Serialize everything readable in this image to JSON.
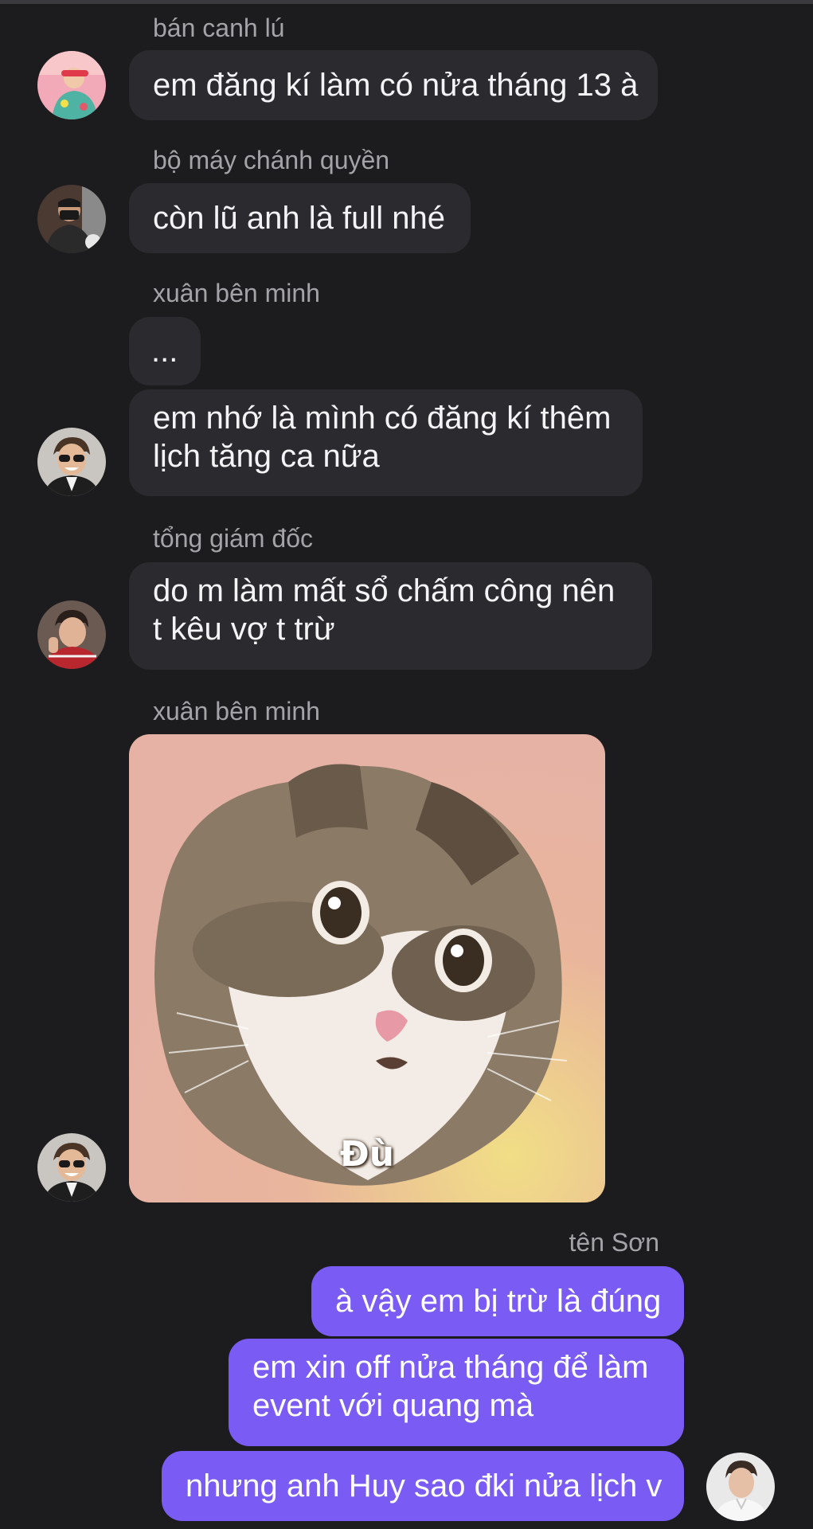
{
  "messages": [
    {
      "sender": "bán canh lú",
      "lines": [
        "em đăng kí làm có nửa tháng 13 à"
      ]
    },
    {
      "sender": "bộ máy chánh quyền",
      "lines": [
        "còn lũ anh là full nhé"
      ]
    },
    {
      "sender": "xuân bên minh",
      "lines": [
        "...",
        "em nhớ là mình có đăng kí thêm lịch tăng ca nữa"
      ]
    },
    {
      "sender": "tổng giám đốc",
      "lines": [
        "do m làm mất sổ chấm công nên t kêu vợ t trừ"
      ]
    },
    {
      "sender": "xuân bên minh",
      "sticker_caption": "Đù"
    },
    {
      "sender": "tên Sơn",
      "outgoing": true,
      "lines": [
        "à vậy em bị trừ là đúng",
        "em xin off nửa tháng để làm event với quang mà",
        "nhưng anh Huy sao đki nửa lịch v"
      ]
    }
  ],
  "colors": {
    "background": "#1c1c1e",
    "incoming_bubble": "#2b2b2f",
    "outgoing_bubble": "#7a5cf5",
    "sender_name": "#a3a3a8"
  }
}
